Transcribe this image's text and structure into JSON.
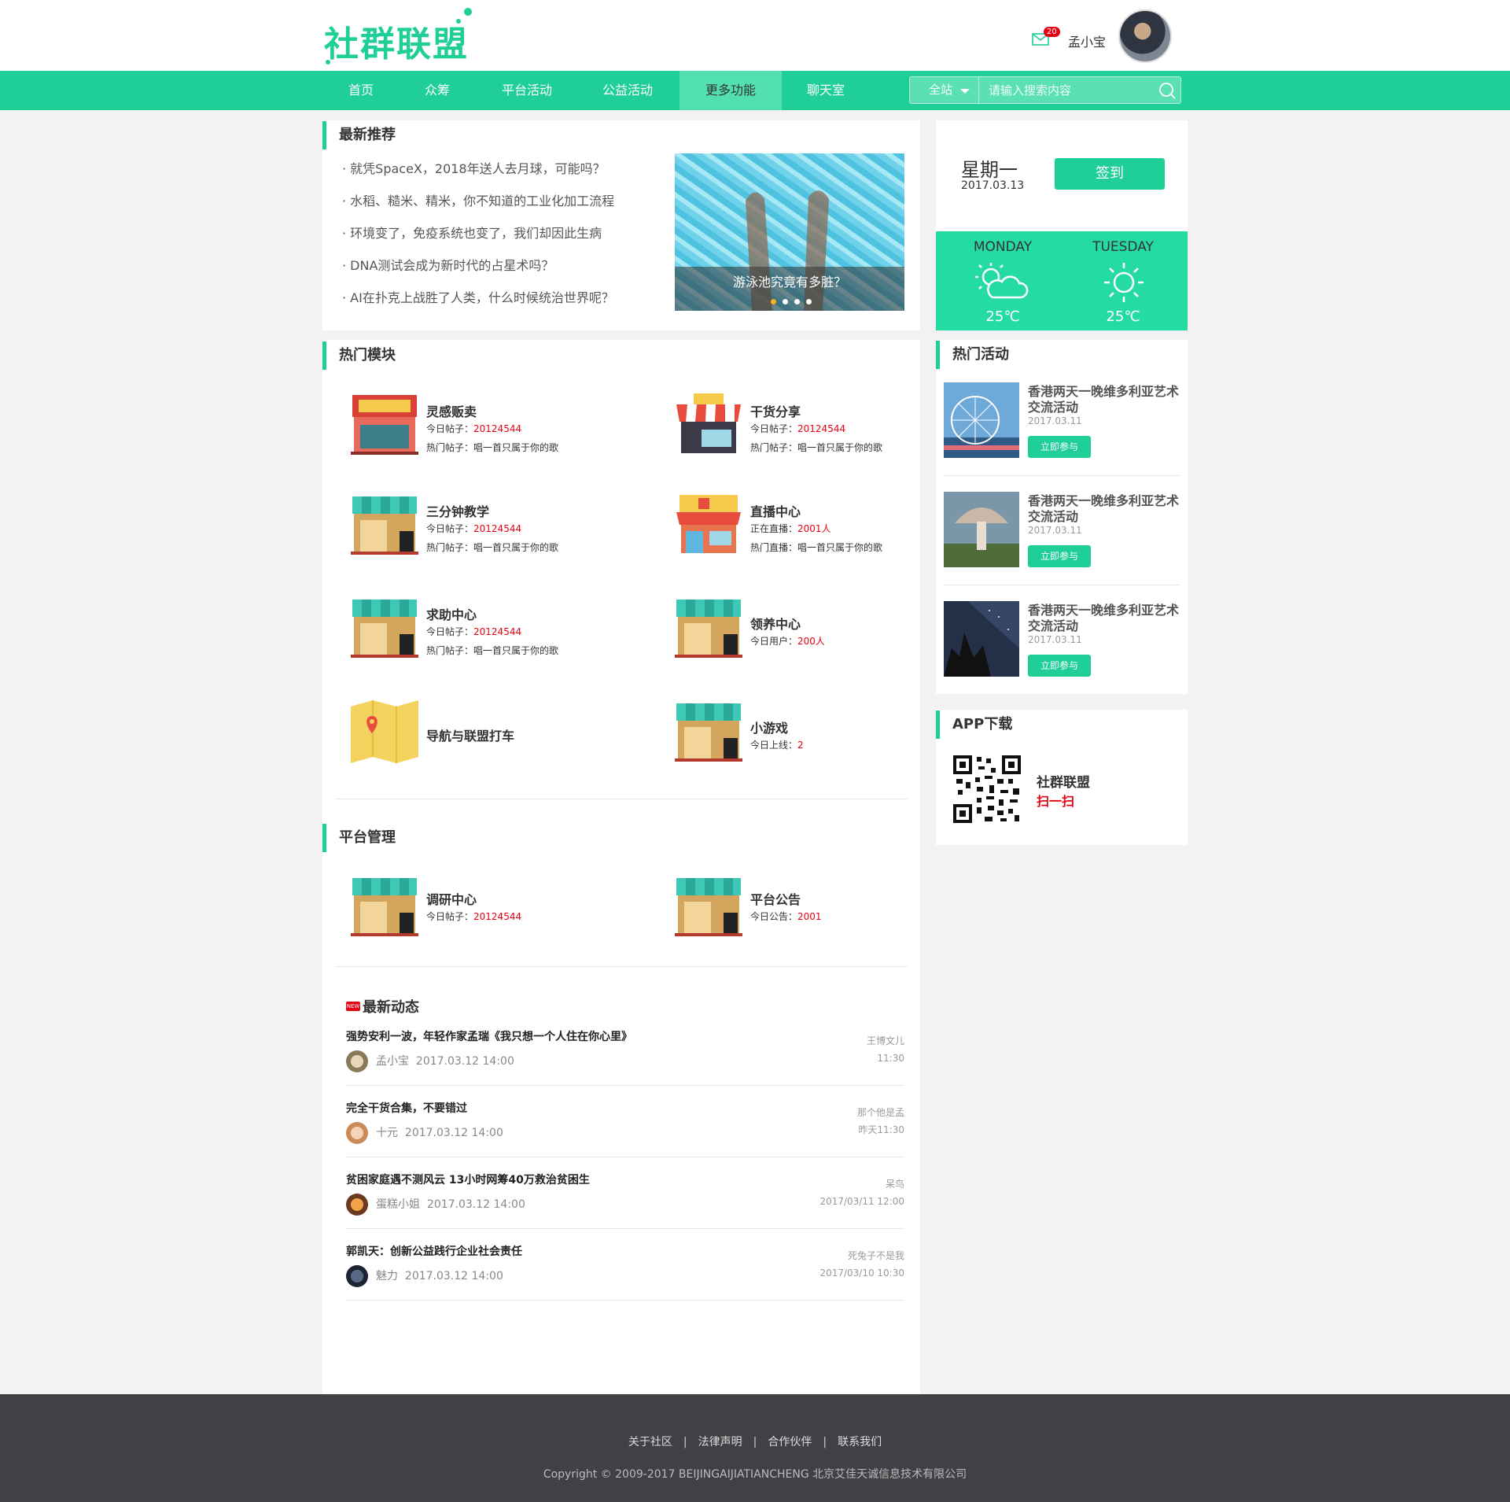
{
  "header": {
    "logo": "社群联盟",
    "mail_count": "20",
    "username": "孟小宝"
  },
  "nav": {
    "items": [
      "首页",
      "众筹",
      "平台活动",
      "公益活动",
      "更多功能",
      "聊天室"
    ],
    "active": "更多功能",
    "search_scope": "全站",
    "search_placeholder": "请输入搜索内容"
  },
  "recommend": {
    "title": "最新推荐",
    "items": [
      "· 就凭SpaceX，2018年送人去月球，可能吗？",
      "· 水稻、糙米、精米，你不知道的工业化加工流程",
      "· 环境变了，免疫系统也变了，我们却因此生病",
      "· DNA测试会成为新时代的占星术吗？",
      "· AI在扑克上战胜了人类，什么时候统治世界呢？"
    ],
    "banner_caption": "游泳池究竟有多脏？"
  },
  "hot_modules": {
    "title": "热门模块",
    "items": [
      {
        "name": "灵感贩卖",
        "l1_label": "今日帖子：",
        "l1_value": "20124544",
        "l2": "热门帖子：唱一首只属于你的歌"
      },
      {
        "name": "干货分享",
        "l1_label": "今日帖子：",
        "l1_value": "20124544",
        "l2": "热门帖子：唱一首只属于你的歌"
      },
      {
        "name": "三分钟教学",
        "l1_label": "今日帖子：",
        "l1_value": "20124544",
        "l2": "热门帖子：唱一首只属于你的歌"
      },
      {
        "name": "直播中心",
        "l1_label": "正在直播：",
        "l1_value": "2001人",
        "l2": "热门直播：唱一首只属于你的歌"
      },
      {
        "name": "求助中心",
        "l1_label": "今日帖子：",
        "l1_value": "20124544",
        "l2": "热门帖子：唱一首只属于你的歌"
      },
      {
        "name": "领养中心",
        "l1_label": "今日用户：",
        "l1_value": "200人",
        "l2": ""
      },
      {
        "name": "导航与联盟打车",
        "l1_label": "",
        "l1_value": "",
        "l2": ""
      },
      {
        "name": "小游戏",
        "l1_label": "今日上线：",
        "l1_value": "2",
        "l2": ""
      }
    ]
  },
  "platform": {
    "title": "平台管理",
    "items": [
      {
        "name": "调研中心",
        "l1_label": "今日帖子：",
        "l1_value": "20124544"
      },
      {
        "name": "平台公告",
        "l1_label": "今日公告：",
        "l1_value": "2001"
      }
    ]
  },
  "feed": {
    "badge": "NEW",
    "title": "最新动态",
    "items": [
      {
        "title": "强势安利一波，年轻作家孟瑞《我只想一个人住在你心里》",
        "author": "孟小宝",
        "date": "2017.03.12  14:00",
        "reply_user": "王博文儿",
        "reply_time": "11:30"
      },
      {
        "title": "完全干货合集，不要错过",
        "author": "十元",
        "date": "2017.03.12  14:00",
        "reply_user": "那个他是孟",
        "reply_time": "昨天11:30"
      },
      {
        "title": "贫困家庭遇不测风云 13小时网筹40万救治贫困生",
        "author": "蛋糕小姐",
        "date": "2017.03.12  14:00",
        "reply_user": "呆鸟",
        "reply_time": "2017/03/11 12:00"
      },
      {
        "title": "郭凯天：创新公益践行企业社会责任",
        "author": "魅力",
        "date": "2017.03.12  14:00",
        "reply_user": "死兔子不是我",
        "reply_time": "2017/03/10 10:30"
      }
    ]
  },
  "signin": {
    "weekday": "星期一",
    "date": "2017.03.13",
    "button": "签到"
  },
  "weather": [
    {
      "day": "MONDAY",
      "temp": "25℃",
      "icon": "partly-cloudy-icon"
    },
    {
      "day": "TUESDAY",
      "temp": "25℃",
      "icon": "sunny-icon"
    }
  ],
  "activities": {
    "title": "热门活动",
    "items": [
      {
        "title": "香港两天一晚维多利亚艺术交流活动",
        "date": "2017.03.11",
        "button": "立即参与"
      },
      {
        "title": "香港两天一晚维多利亚艺术交流活动",
        "date": "2017.03.11",
        "button": "立即参与"
      },
      {
        "title": "香港两天一晚维多利亚艺术交流活动",
        "date": "2017.03.11",
        "button": "立即参与"
      }
    ]
  },
  "app": {
    "title": "APP下载",
    "name": "社群联盟",
    "sub": "扫一扫"
  },
  "footer": {
    "links": [
      "关于社区",
      "法律声明",
      "合作伙伴",
      "联系我们"
    ],
    "separator": "|",
    "copyright": "Copyright © 2009-2017 BEIJINGAIJIATIANCHENG 北京艾佳天诚信息技术有限公司"
  },
  "colors": {
    "brand": "#1fcf97",
    "accent_red": "#e60012",
    "footer_bg": "#404145"
  }
}
